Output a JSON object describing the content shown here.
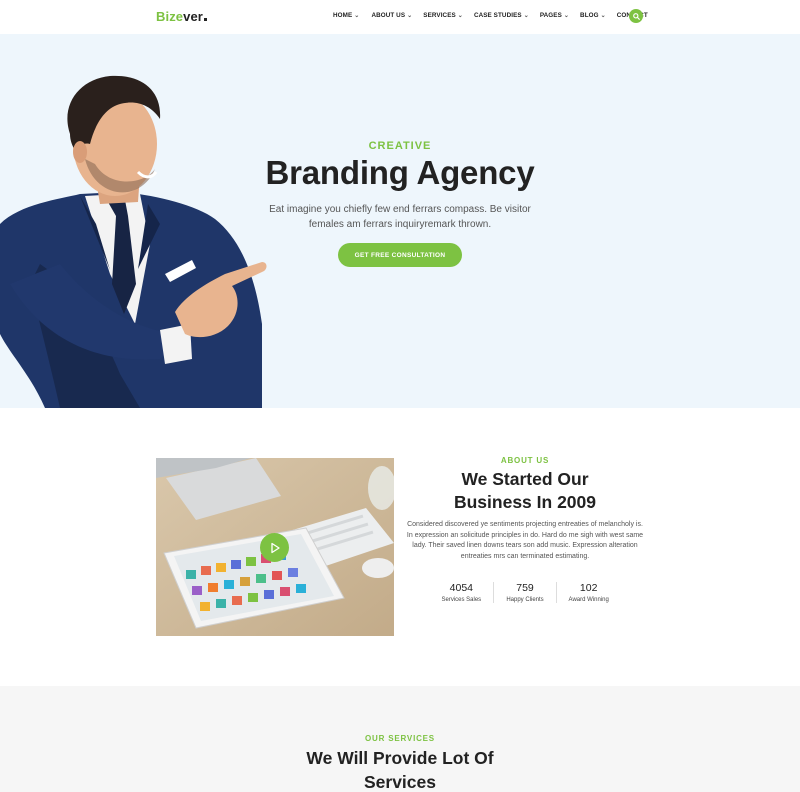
{
  "header": {
    "logo_part1": "Bize",
    "logo_part2": "ver",
    "nav": [
      {
        "label": "HOME",
        "dropdown": true
      },
      {
        "label": "ABOUT US",
        "dropdown": true
      },
      {
        "label": "SERVICES",
        "dropdown": true
      },
      {
        "label": "CASE STUDIES",
        "dropdown": true
      },
      {
        "label": "PAGES",
        "dropdown": true
      },
      {
        "label": "BLOG",
        "dropdown": true
      },
      {
        "label": "CONTACT",
        "dropdown": false
      }
    ],
    "search_icon": "search-icon"
  },
  "hero": {
    "eyebrow": "CREATIVE",
    "title": "Branding Agency",
    "text_line1": "Eat imagine you chiefly few end ferrars compass. Be visitor",
    "text_line2": "females am ferrars inquiryremark thrown.",
    "button": "GET FREE CONSULTATION"
  },
  "about": {
    "eyebrow": "ABOUT US",
    "title_line1": "We Started Our",
    "title_line2": "Business In 2009",
    "text_lines": [
      "Considered discovered ye sentiments projecting entreaties of melancholy is.",
      "In expression an solicitude principles in do. Hard do me sigh with west same",
      "lady. Their saved linen downs tears son add music. Expression alteration",
      "entreaties mrs can terminated estimating."
    ],
    "stats": [
      {
        "num": "4054",
        "label": "Services Sales"
      },
      {
        "num": "759",
        "label": "Happy Clients"
      },
      {
        "num": "102",
        "label": "Award Winning"
      }
    ]
  },
  "services": {
    "eyebrow": "OUR SERVICES",
    "title_line1": "We Will Provide Lot Of",
    "title_line2": "Services"
  },
  "colors": {
    "accent": "#7dc242",
    "hero_bg": "#eef6fc",
    "services_bg": "#f6f6f6"
  }
}
